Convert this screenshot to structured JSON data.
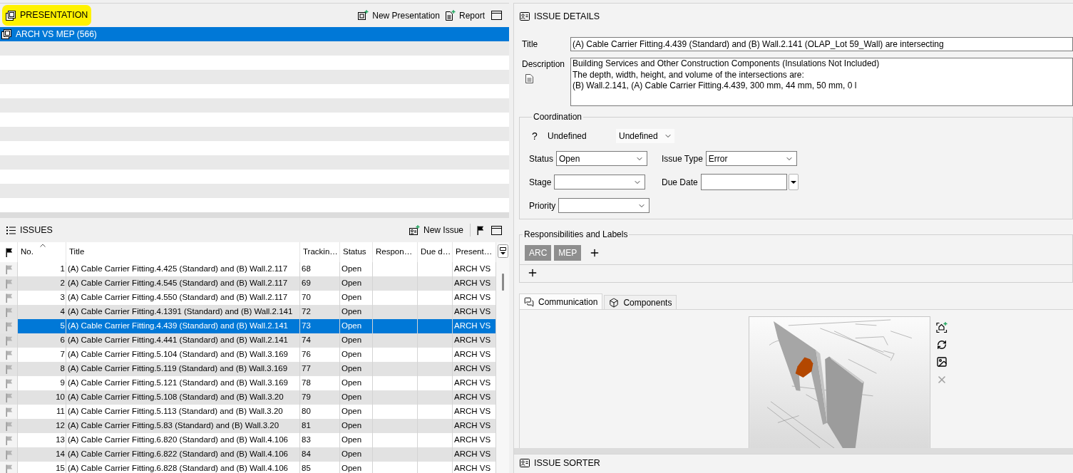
{
  "presentation_panel": {
    "title": "PRESENTATION",
    "highlighted": true,
    "actions": [
      {
        "label": "New Presentation",
        "kind": "new_presentation"
      },
      {
        "label": "Report",
        "kind": "report"
      }
    ],
    "items": [
      {
        "label": "ARCH VS MEP (566)",
        "selected": true
      }
    ]
  },
  "issues_panel": {
    "title": "ISSUES",
    "actions": [
      {
        "label": "New Issue",
        "kind": "new_issue"
      }
    ],
    "table": {
      "columns": [
        {
          "label": "No.",
          "sorted": true
        },
        {
          "label": "Title",
          "sorted": false
        },
        {
          "label": "Trackin…",
          "sorted": false
        },
        {
          "label": "Status",
          "sorted": false
        },
        {
          "label": "Respon…",
          "sorted": false
        },
        {
          "label": "Due d…",
          "sorted": false
        },
        {
          "label": "Present…",
          "sorted": false
        }
      ],
      "rows": [
        {
          "no": "1",
          "title": "(A) Cable Carrier Fitting.4.425 (Standard) and (B) Wall.2.117",
          "tracking": "68",
          "status": "Open",
          "presentation": "ARCH VS",
          "selected": false
        },
        {
          "no": "2",
          "title": "(A) Cable Carrier Fitting.4.545 (Standard) and (B) Wall.2.117",
          "tracking": "69",
          "status": "Open",
          "presentation": "ARCH VS",
          "selected": false
        },
        {
          "no": "3",
          "title": "(A) Cable Carrier Fitting.4.550 (Standard) and (B) Wall.2.117",
          "tracking": "70",
          "status": "Open",
          "presentation": "ARCH VS",
          "selected": false
        },
        {
          "no": "4",
          "title": "(A) Cable Carrier Fitting.4.1391 (Standard) and (B) Wall.2.141",
          "tracking": "72",
          "status": "Open",
          "presentation": "ARCH VS",
          "selected": false
        },
        {
          "no": "5",
          "title": "(A) Cable Carrier Fitting.4.439 (Standard) and (B) Wall.2.141",
          "tracking": "73",
          "status": "Open",
          "presentation": "ARCH VS",
          "selected": true
        },
        {
          "no": "6",
          "title": "(A) Cable Carrier Fitting.4.441 (Standard) and (B) Wall.2.141",
          "tracking": "74",
          "status": "Open",
          "presentation": "ARCH VS",
          "selected": false
        },
        {
          "no": "7",
          "title": "(A) Cable Carrier Fitting.5.104 (Standard) and (B) Wall.3.169",
          "tracking": "76",
          "status": "Open",
          "presentation": "ARCH VS",
          "selected": false
        },
        {
          "no": "8",
          "title": "(A) Cable Carrier Fitting.5.119 (Standard) and (B) Wall.3.169",
          "tracking": "77",
          "status": "Open",
          "presentation": "ARCH VS",
          "selected": false
        },
        {
          "no": "9",
          "title": "(A) Cable Carrier Fitting.5.121 (Standard) and (B) Wall.3.169",
          "tracking": "78",
          "status": "Open",
          "presentation": "ARCH VS",
          "selected": false
        },
        {
          "no": "10",
          "title": "(A) Cable Carrier Fitting.5.108 (Standard) and (B) Wall.3.20",
          "tracking": "79",
          "status": "Open",
          "presentation": "ARCH VS",
          "selected": false
        },
        {
          "no": "11",
          "title": "(A) Cable Carrier Fitting.5.113 (Standard) and (B) Wall.3.20",
          "tracking": "80",
          "status": "Open",
          "presentation": "ARCH VS",
          "selected": false
        },
        {
          "no": "12",
          "title": "(A) Cable Carrier Fitting.5.83 (Standard) and (B) Wall.3.20",
          "tracking": "81",
          "status": "Open",
          "presentation": "ARCH VS",
          "selected": false
        },
        {
          "no": "13",
          "title": "(A) Cable Carrier Fitting.6.820 (Standard) and (B) Wall.4.106",
          "tracking": "83",
          "status": "Open",
          "presentation": "ARCH VS",
          "selected": false
        },
        {
          "no": "14",
          "title": "(A) Cable Carrier Fitting.6.822 (Standard) and (B) Wall.4.106",
          "tracking": "84",
          "status": "Open",
          "presentation": "ARCH VS",
          "selected": false
        },
        {
          "no": "15",
          "title": "(A) Cable Carrier Fitting.6.828 (Standard) and (B) Wall.4.106",
          "tracking": "85",
          "status": "Open",
          "presentation": "ARCH VS",
          "selected": false
        }
      ]
    }
  },
  "issue_details": {
    "title": "ISSUE DETAILS",
    "title_field": {
      "label": "Title",
      "value": "(A) Cable Carrier Fitting.4.439 (Standard) and (B) Wall.2.141 (OLAP_Lot 59_Wall) are intersecting"
    },
    "description_field": {
      "label": "Description",
      "lines": [
        "Building Services and Other Construction Components (Insulations Not Included)",
        "The depth, width, height, and volume of the intersections are:",
        "(B) Wall.2.141, (A) Cable Carrier Fitting.4.439, 300 mm, 44 mm, 50 mm, 0 l"
      ]
    },
    "coordination": {
      "title": "Coordination",
      "state": {
        "symbol": "?",
        "label": "Undefined",
        "value": "Undefined"
      },
      "fields": [
        {
          "label": "Status",
          "kind": "select",
          "value": "Open"
        },
        {
          "label": "Issue Type",
          "kind": "select",
          "value": "Error"
        },
        {
          "label": "Stage",
          "kind": "select"
        },
        {
          "label": "Due Date",
          "kind": "date"
        },
        {
          "label": "Priority",
          "kind": "select"
        }
      ]
    },
    "responsibilities": {
      "title": "Responsibilities and Labels",
      "items": [
        "ARC",
        "MEP"
      ]
    },
    "tabs": [
      {
        "label": "Communication",
        "kind": "chat",
        "selected": true
      },
      {
        "label": "Components",
        "kind": "box",
        "selected": false
      }
    ],
    "image_tools": [
      {
        "kind": "capture",
        "disabled": false
      },
      {
        "kind": "refresh",
        "disabled": false
      },
      {
        "kind": "image",
        "disabled": false
      },
      {
        "kind": "delete",
        "disabled": true
      }
    ]
  },
  "issue_sorter": {
    "title": "ISSUE SORTER"
  }
}
